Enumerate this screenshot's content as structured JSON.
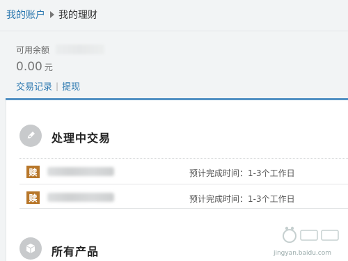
{
  "breadcrumb": {
    "root": "我的账户",
    "current": "我的理财"
  },
  "balance": {
    "label": "可用余额",
    "amount": "0.00",
    "unit": "元"
  },
  "links": {
    "transactions": "交易记录",
    "separator": "|",
    "withdraw": "提现"
  },
  "pending": {
    "title": "处理中交易",
    "rows": [
      {
        "badge": "赎",
        "estimate": "预计完成时间：1-3个工作日"
      },
      {
        "badge": "赎",
        "estimate": "预计完成时间：1-3个工作日"
      }
    ]
  },
  "products": {
    "title": "所有产品"
  },
  "watermark": {
    "url": "jingyan.baidu.com"
  },
  "colors": {
    "link": "#2b78b0",
    "accent_bar": "#5290c3",
    "redeem_badge": "#b8772a",
    "icon_circle": "#c8cacc"
  }
}
